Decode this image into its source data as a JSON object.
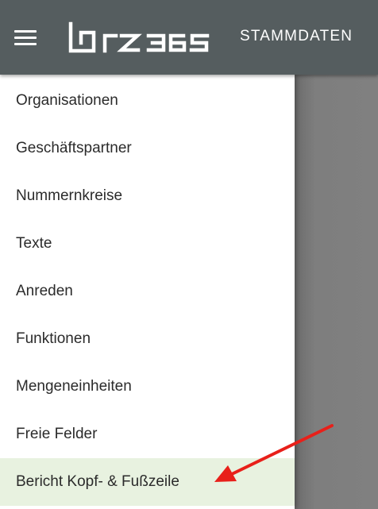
{
  "appbar": {
    "menu_icon": "hamburger-icon",
    "logo_text": "brz 365",
    "title": "STAMMDATEN"
  },
  "drawer": {
    "items": [
      {
        "label": "Organisationen"
      },
      {
        "label": "Geschäftspartner"
      },
      {
        "label": "Nummernkreise"
      },
      {
        "label": "Texte"
      },
      {
        "label": "Anreden"
      },
      {
        "label": "Funktionen"
      },
      {
        "label": "Mengeneinheiten"
      },
      {
        "label": "Freie Felder"
      },
      {
        "label": "Bericht Kopf- & Fußzeile",
        "active": true
      }
    ]
  },
  "colors": {
    "appbar": "#555d5f",
    "active_item_bg": "#e8f2e0",
    "annotation_arrow": "#e8201a"
  },
  "annotation": {
    "icon": "red-arrow-icon"
  }
}
